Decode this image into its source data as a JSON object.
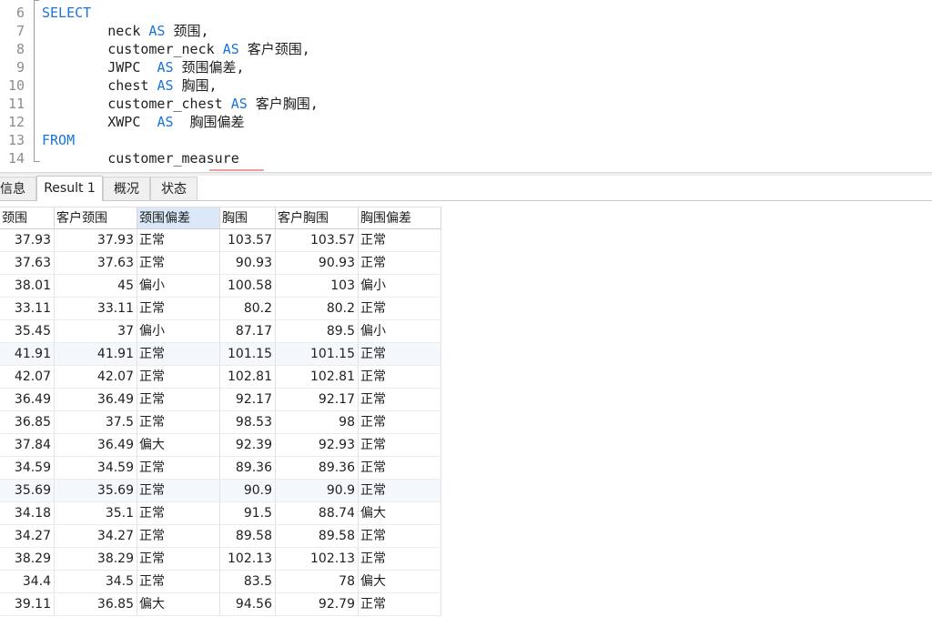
{
  "editor": {
    "lines": [
      {
        "no": "6",
        "parts": [
          [
            "SELECT",
            "kw"
          ]
        ]
      },
      {
        "no": "7",
        "parts": [
          [
            "        neck ",
            ""
          ],
          [
            "AS",
            "kw"
          ],
          [
            " 颈围,",
            ""
          ]
        ]
      },
      {
        "no": "8",
        "parts": [
          [
            "        customer_neck ",
            ""
          ],
          [
            "AS",
            "kw"
          ],
          [
            " 客户颈围,",
            ""
          ]
        ]
      },
      {
        "no": "9",
        "parts": [
          [
            "        JWPC  ",
            ""
          ],
          [
            "AS",
            "kw"
          ],
          [
            " 颈围偏差,",
            ""
          ]
        ]
      },
      {
        "no": "10",
        "parts": [
          [
            "        chest ",
            ""
          ],
          [
            "AS",
            "kw"
          ],
          [
            " 胸围,",
            ""
          ]
        ]
      },
      {
        "no": "11",
        "parts": [
          [
            "        customer_chest ",
            ""
          ],
          [
            "AS",
            "kw"
          ],
          [
            " 客户胸围,",
            ""
          ]
        ]
      },
      {
        "no": "12",
        "parts": [
          [
            "        XWPC  ",
            ""
          ],
          [
            "AS",
            "kw"
          ],
          [
            "  胸围偏差",
            ""
          ]
        ]
      },
      {
        "no": "13",
        "parts": [
          [
            "FROM",
            "kw"
          ]
        ]
      },
      {
        "no": "14",
        "parts": [
          [
            "        customer_measure",
            ""
          ]
        ]
      }
    ]
  },
  "tabs": [
    {
      "label": "信息",
      "active": false
    },
    {
      "label": "Result 1",
      "active": true
    },
    {
      "label": "概况",
      "active": false
    },
    {
      "label": "状态",
      "active": false
    }
  ],
  "grid": {
    "columns": [
      "颈围",
      "客户颈围",
      "颈围偏差",
      "胸围",
      "客户胸围",
      "胸围偏差"
    ],
    "selected_column": 2,
    "rows": [
      [
        "37.93",
        "37.93",
        "正常",
        "103.57",
        "103.57",
        "正常"
      ],
      [
        "37.63",
        "37.63",
        "正常",
        "90.93",
        "90.93",
        "正常"
      ],
      [
        "38.01",
        "45",
        "偏小",
        "100.58",
        "103",
        "偏小"
      ],
      [
        "33.11",
        "33.11",
        "正常",
        "80.2",
        "80.2",
        "正常"
      ],
      [
        "35.45",
        "37",
        "偏小",
        "87.17",
        "89.5",
        "偏小"
      ],
      [
        "41.91",
        "41.91",
        "正常",
        "101.15",
        "101.15",
        "正常"
      ],
      [
        "42.07",
        "42.07",
        "正常",
        "102.81",
        "102.81",
        "正常"
      ],
      [
        "36.49",
        "36.49",
        "正常",
        "92.17",
        "92.17",
        "正常"
      ],
      [
        "36.85",
        "37.5",
        "正常",
        "98.53",
        "98",
        "正常"
      ],
      [
        "37.84",
        "36.49",
        "偏大",
        "92.39",
        "92.93",
        "正常"
      ],
      [
        "34.59",
        "34.59",
        "正常",
        "89.36",
        "89.36",
        "正常"
      ],
      [
        "35.69",
        "35.69",
        "正常",
        "90.9",
        "90.9",
        "正常"
      ],
      [
        "34.18",
        "35.1",
        "正常",
        "91.5",
        "88.74",
        "偏大"
      ],
      [
        "34.27",
        "34.27",
        "正常",
        "89.58",
        "89.58",
        "正常"
      ],
      [
        "38.29",
        "38.29",
        "正常",
        "102.13",
        "102.13",
        "正常"
      ],
      [
        "34.4",
        "34.5",
        "正常",
        "83.5",
        "78",
        "偏大"
      ],
      [
        "39.11",
        "36.85",
        "偏大",
        "94.56",
        "92.79",
        "正常"
      ]
    ],
    "highlighted_rows": [
      5,
      11
    ]
  }
}
